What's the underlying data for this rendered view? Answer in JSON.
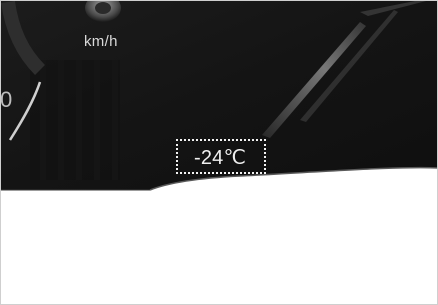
{
  "cluster": {
    "speed_unit": "km/h",
    "speed_partial_digit": "0",
    "outside_temperature": "-24℃"
  },
  "colors": {
    "panel_background": "#121212",
    "text": "#e6e6e6",
    "highlight_box": "#f2f2f2",
    "page_background": "#ffffff"
  }
}
